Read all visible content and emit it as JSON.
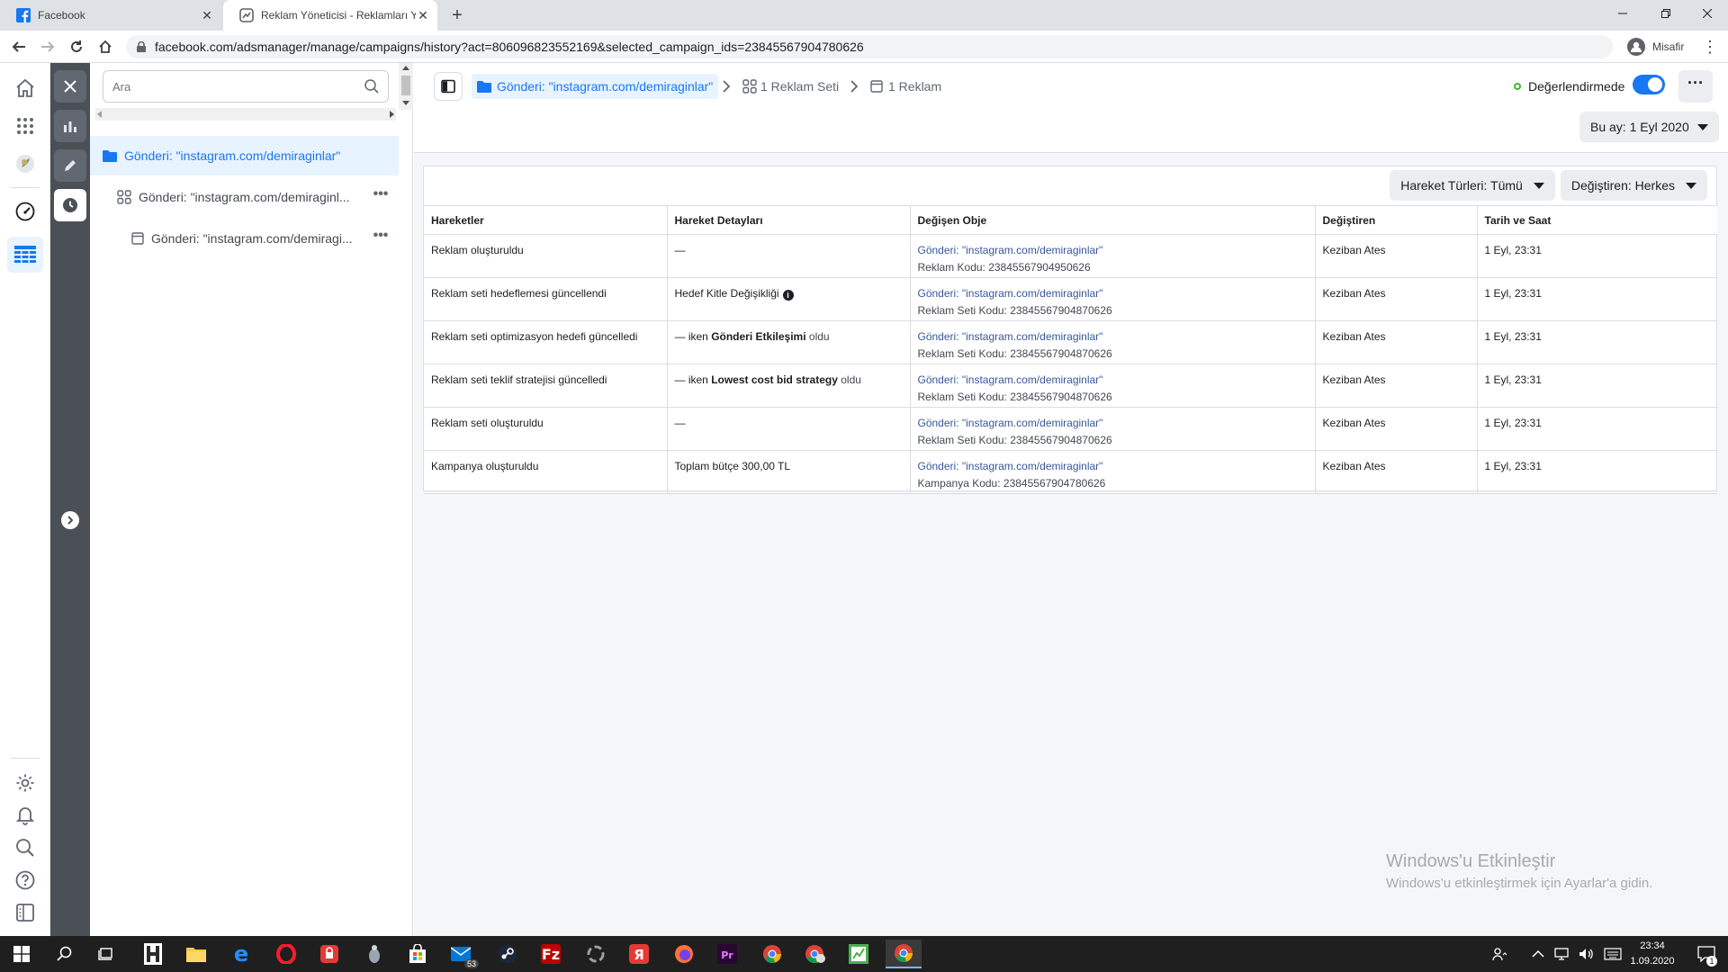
{
  "browser": {
    "tabs": [
      {
        "title": "Facebook",
        "active": false
      },
      {
        "title": "Reklam Yöneticisi - Reklamları Yö",
        "active": true
      }
    ],
    "url": "facebook.com/adsmanager/manage/campaigns/history?act=806096823552169&selected_campaign_ids=23845567904780626",
    "profile_label": "Misafir"
  },
  "colors": {
    "accent": "#1877f2",
    "link": "#385898",
    "status_green": "#42b72a"
  },
  "sidebar_icons": [
    "home-icon",
    "apps-grid-icon",
    "account-avatar",
    "dashboard-gauge-icon",
    "table-icon",
    "settings-icon",
    "bell-icon",
    "search-icon",
    "help-icon",
    "panel-icon"
  ],
  "tree": {
    "search_placeholder": "Ara",
    "items": [
      {
        "label": "Gönderi: \"instagram.com/demiraginlar\"",
        "level": "campaign",
        "selected": true
      },
      {
        "label": "Gönderi: \"instagram.com/demiraginl...",
        "level": "adset",
        "selected": false
      },
      {
        "label": "Gönderi: \"instagram.com/demiragi...",
        "level": "ad",
        "selected": false
      }
    ]
  },
  "breadcrumb": {
    "campaign": "Gönderi: \"instagram.com/demiraginlar\"",
    "adset": "1 Reklam Seti",
    "ad": "1 Reklam"
  },
  "status": {
    "label": "Değerlendirmede",
    "toggle_on": true
  },
  "date_range": {
    "label": "Bu ay: 1 Eyl 2020"
  },
  "filters": {
    "action_types": "Hareket Türleri: Tümü",
    "changed_by": "Değiştiren: Herkes"
  },
  "table": {
    "headers": [
      "Hareketler",
      "Hareket Detayları",
      "Değişen Obje",
      "Değiştiren",
      "Tarih ve Saat"
    ],
    "rows": [
      {
        "action": "Reklam oluşturuldu",
        "detail": "—",
        "object": "Gönderi: \"instagram.com/demiraginlar\"",
        "code": "Reklam Kodu: 23845567904950626",
        "by": "Keziban Ates",
        "time": "1 Eyl, 23:31"
      },
      {
        "action": "Reklam seti hedeflemesi güncellendi",
        "detail": "Hedef Kitle Değişikliği",
        "object": "Gönderi: \"instagram.com/demiraginlar\"",
        "code": "Reklam Seti Kodu: 23845567904870626",
        "by": "Keziban Ates",
        "time": "1 Eyl, 23:31"
      },
      {
        "action": "Reklam seti optimizasyon hedefi güncelledi",
        "detail_pre": "— iken ",
        "detail_bold": "Gönderi Etkileşimi",
        "detail_post": " oldu",
        "object": "Gönderi: \"instagram.com/demiraginlar\"",
        "code": "Reklam Seti Kodu: 23845567904870626",
        "by": "Keziban Ates",
        "time": "1 Eyl, 23:31"
      },
      {
        "action": "Reklam seti teklif stratejisi güncelledi",
        "detail_pre": "— iken ",
        "detail_bold": "Lowest cost bid strategy",
        "detail_post": " oldu",
        "object": "Gönderi: \"instagram.com/demiraginlar\"",
        "code": "Reklam Seti Kodu: 23845567904870626",
        "by": "Keziban Ates",
        "time": "1 Eyl, 23:31"
      },
      {
        "action": "Reklam seti oluşturuldu",
        "detail": "—",
        "object": "Gönderi: \"instagram.com/demiraginlar\"",
        "code": "Reklam Seti Kodu: 23845567904870626",
        "by": "Keziban Ates",
        "time": "1 Eyl, 23:31"
      },
      {
        "action": "Kampanya oluşturuldu",
        "detail": "Toplam bütçe 300,00 TL",
        "object": "Gönderi: \"instagram.com/demiraginlar\"",
        "code": "Kampanya Kodu: 23845567904780626",
        "by": "Keziban Ates",
        "time": "1 Eyl, 23:31"
      }
    ]
  },
  "watermark": {
    "title": "Windows'u Etkinleştir",
    "subtitle": "Windows'u etkinleştirmek için Ayarlar'a gidin."
  },
  "taskbar": {
    "apps": [
      "start",
      "search",
      "task-view",
      "app-h",
      "file-explorer",
      "edge",
      "opera",
      "app-red",
      "app-bug",
      "store",
      "mail",
      "steam",
      "filezilla",
      "app-circle",
      "yandex",
      "firefox",
      "premiere",
      "chrome",
      "chrome-profile",
      "app-chart",
      "chrome-active"
    ],
    "mail_badge": "53",
    "time": "23:34",
    "date": "1.09.2020",
    "notification_count": "1"
  }
}
